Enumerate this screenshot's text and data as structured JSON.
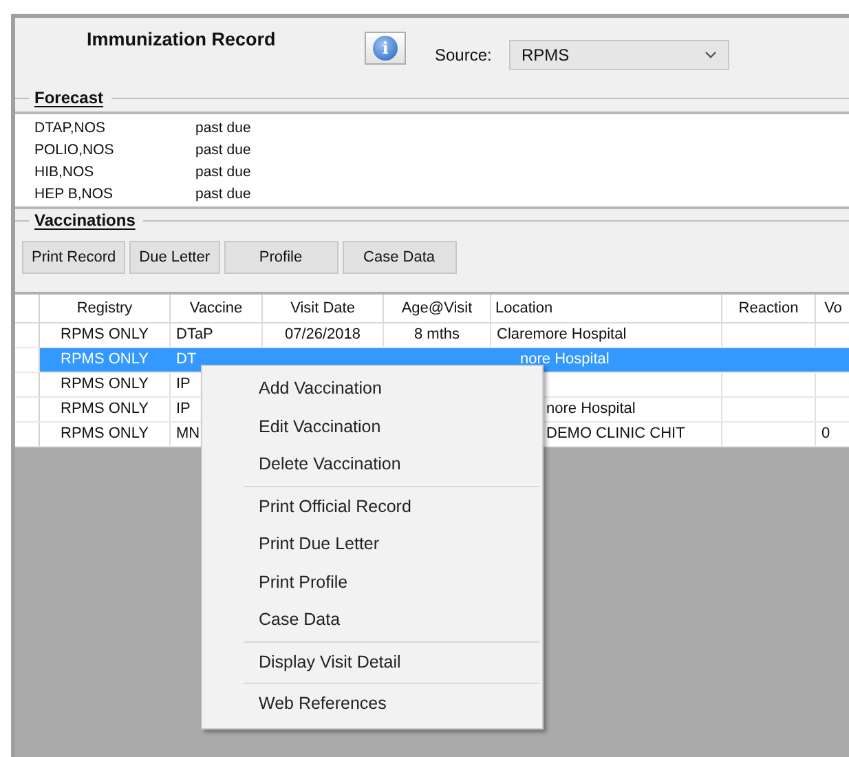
{
  "header": {
    "title": "Immunization Record",
    "info_button": "i",
    "source_label": "Source:",
    "source_value": "RPMS"
  },
  "forecast": {
    "label": "Forecast",
    "items": [
      {
        "vaccine": "DTAP,NOS",
        "status": "past due"
      },
      {
        "vaccine": "POLIO,NOS",
        "status": "past due"
      },
      {
        "vaccine": "HIB,NOS",
        "status": "past due"
      },
      {
        "vaccine": "HEP B,NOS",
        "status": "past due"
      }
    ]
  },
  "vaccinations": {
    "label": "Vaccinations",
    "buttons": [
      "Print Record",
      "Due Letter",
      "Profile",
      "Case Data"
    ]
  },
  "table": {
    "columns": [
      "Registry",
      "Vaccine",
      "Visit Date",
      "Age@Visit",
      "Location",
      "Reaction",
      "Vo"
    ],
    "rows": [
      {
        "selected": false,
        "cells": [
          "RPMS ONLY",
          "DTaP",
          "07/26/2018",
          "8 mths",
          "Claremore Hospital",
          "",
          ""
        ]
      },
      {
        "selected": true,
        "cells": [
          "RPMS ONLY",
          "DT",
          "",
          "",
          "nore Hospital",
          "",
          ""
        ]
      },
      {
        "selected": false,
        "cells": [
          "RPMS ONLY",
          "IP",
          "",
          "",
          "",
          "",
          ""
        ]
      },
      {
        "selected": false,
        "cells": [
          "RPMS ONLY",
          "IP",
          "",
          "",
          "nore Hospital",
          "",
          ""
        ]
      },
      {
        "selected": false,
        "cells": [
          "RPMS ONLY",
          "MN",
          "",
          "",
          "DEMO CLINIC CHIT",
          "",
          "0"
        ]
      }
    ]
  },
  "context_menu": {
    "groups": [
      [
        "Add Vaccination",
        "Edit Vaccination",
        "Delete Vaccination"
      ],
      [
        "Print Official Record",
        "Print Due Letter",
        "Print Profile",
        "Case Data"
      ],
      [
        "Display Visit Detail"
      ],
      [
        "Web References"
      ]
    ]
  }
}
